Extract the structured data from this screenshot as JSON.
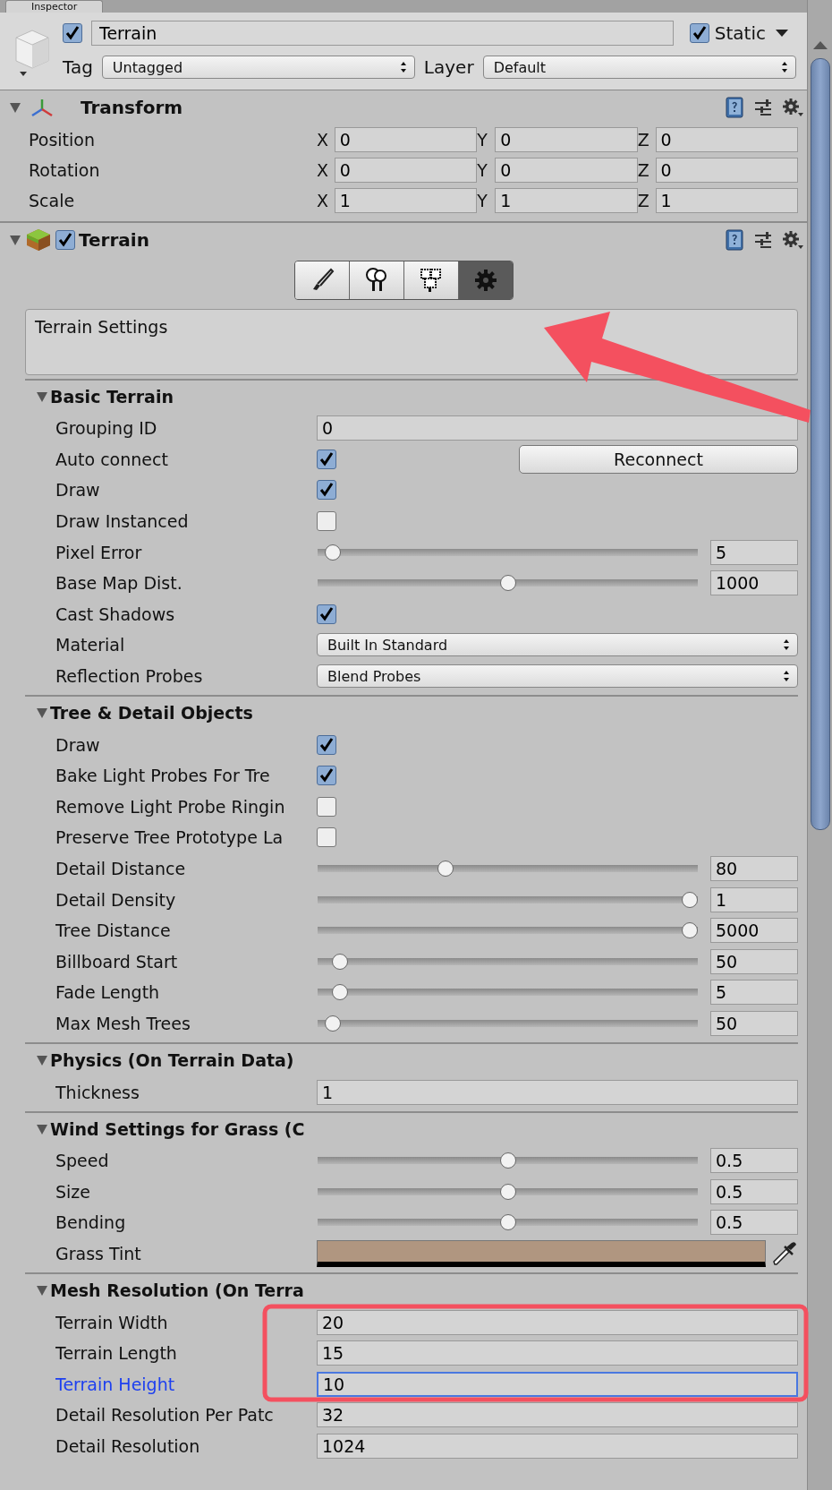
{
  "tab": {
    "label": "Inspector"
  },
  "object": {
    "active": true,
    "name": "Terrain",
    "static": true,
    "static_label": "Static",
    "tag_label": "Tag",
    "tag": "Untagged",
    "layer_label": "Layer",
    "layer": "Default"
  },
  "transform": {
    "title": "Transform",
    "expanded": true,
    "rows": [
      {
        "label": "Position",
        "axes": [
          {
            "axis": "X",
            "value": "0"
          },
          {
            "axis": "Y",
            "value": "0"
          },
          {
            "axis": "Z",
            "value": "0"
          }
        ]
      },
      {
        "label": "Rotation",
        "axes": [
          {
            "axis": "X",
            "value": "0"
          },
          {
            "axis": "Y",
            "value": "0"
          },
          {
            "axis": "Z",
            "value": "0"
          }
        ]
      },
      {
        "label": "Scale",
        "axes": [
          {
            "axis": "X",
            "value": "1"
          },
          {
            "axis": "Y",
            "value": "1"
          },
          {
            "axis": "Z",
            "value": "1"
          }
        ]
      }
    ]
  },
  "terrain": {
    "title": "Terrain",
    "enabled": true,
    "expanded": true,
    "tools": [
      {
        "kind": "paint",
        "selected": false
      },
      {
        "kind": "tree",
        "selected": false
      },
      {
        "kind": "detail",
        "selected": false
      },
      {
        "kind": "settings",
        "selected": true
      }
    ],
    "settings_title": "Terrain Settings",
    "sections": [
      {
        "title": "Basic Terrain",
        "expanded": true,
        "rows": [
          {
            "kind": "text",
            "label": "Grouping ID",
            "value": "0"
          },
          {
            "kind": "check",
            "label": "Auto connect",
            "checked": true,
            "button": "Reconnect"
          },
          {
            "kind": "check",
            "label": "Draw",
            "checked": true
          },
          {
            "kind": "check",
            "label": "Draw Instanced",
            "checked": false
          },
          {
            "kind": "slider",
            "label": "Pixel Error",
            "level": 0.02,
            "value": "5"
          },
          {
            "kind": "slider",
            "label": "Base Map Dist.",
            "level": 0.5,
            "value": "1000"
          },
          {
            "kind": "check",
            "label": "Cast Shadows",
            "checked": true
          },
          {
            "kind": "dropdown",
            "label": "Material",
            "value": "Built In Standard"
          },
          {
            "kind": "dropdown",
            "label": "Reflection Probes",
            "value": "Blend Probes"
          }
        ]
      },
      {
        "title": "Tree & Detail Objects",
        "expanded": true,
        "rows": [
          {
            "kind": "check",
            "label": "Draw",
            "checked": true
          },
          {
            "kind": "check",
            "label": "Bake Light Probes For Tre",
            "checked": true
          },
          {
            "kind": "check",
            "label": "Remove Light Probe Ringin",
            "checked": false
          },
          {
            "kind": "check",
            "label": "Preserve Tree Prototype La",
            "checked": false
          },
          {
            "kind": "slider",
            "label": "Detail Distance",
            "level": 0.33,
            "value": "80"
          },
          {
            "kind": "slider",
            "label": "Detail Density",
            "level": 1,
            "value": "1"
          },
          {
            "kind": "slider",
            "label": "Tree Distance",
            "level": 1,
            "value": "5000"
          },
          {
            "kind": "slider",
            "label": "Billboard Start",
            "level": 0.04,
            "value": "50"
          },
          {
            "kind": "slider",
            "label": "Fade Length",
            "level": 0.04,
            "value": "5"
          },
          {
            "kind": "slider",
            "label": "Max Mesh Trees",
            "level": 0.02,
            "value": "50"
          }
        ]
      },
      {
        "title": "Physics (On Terrain Data)",
        "expanded": true,
        "rows": [
          {
            "kind": "text",
            "label": "Thickness",
            "value": "1"
          }
        ]
      },
      {
        "title": "Wind Settings for Grass (C",
        "expanded": true,
        "rows": [
          {
            "kind": "slider",
            "label": "Speed",
            "level": 0.5,
            "value": "0.5"
          },
          {
            "kind": "slider",
            "label": "Size",
            "level": 0.5,
            "value": "0.5"
          },
          {
            "kind": "slider",
            "label": "Bending",
            "level": 0.5,
            "value": "0.5"
          },
          {
            "kind": "color",
            "label": "Grass Tint",
            "color": "#b09680"
          }
        ]
      },
      {
        "title": "Mesh Resolution (On Terra",
        "expanded": true,
        "rows": [
          {
            "kind": "text",
            "label": "Terrain Width",
            "value": "20",
            "focused": false
          },
          {
            "kind": "text",
            "label": "Terrain Length",
            "value": "15",
            "focused": false
          },
          {
            "kind": "text",
            "label": "Terrain Height",
            "value": "10",
            "focused": true
          },
          {
            "kind": "text",
            "label": "Detail Resolution Per Patc",
            "value": "32",
            "focused": false
          },
          {
            "kind": "text",
            "label": "Detail Resolution",
            "value": "1024",
            "focused": false
          }
        ]
      }
    ]
  }
}
